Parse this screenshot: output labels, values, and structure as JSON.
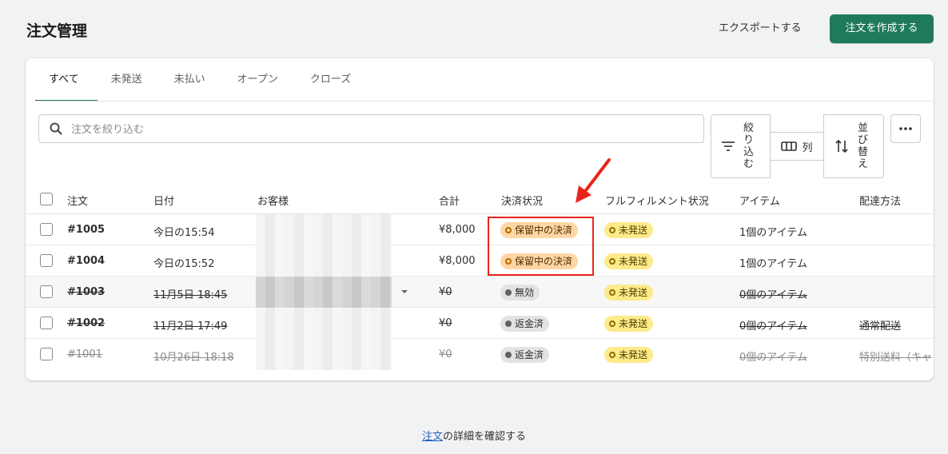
{
  "header": {
    "title": "注文管理",
    "export_label": "エクスポートする",
    "create_label": "注文を作成する"
  },
  "tabs": [
    {
      "label": "すべて",
      "active": true
    },
    {
      "label": "未発送",
      "active": false
    },
    {
      "label": "未払い",
      "active": false
    },
    {
      "label": "オープン",
      "active": false
    },
    {
      "label": "クローズ",
      "active": false
    }
  ],
  "search": {
    "placeholder": "注文を絞り込む",
    "icon": "search-icon"
  },
  "toolbar": {
    "filter_label": [
      "絞",
      "り",
      "込",
      "む"
    ],
    "columns_label": "列",
    "sort_label": [
      "並",
      "び",
      "替",
      "え"
    ],
    "more_icon": "more-horizontal-icon"
  },
  "columns": [
    "注文",
    "日付",
    "お客様",
    "合計",
    "決済状況",
    "フルフィルメント状況",
    "アイテム",
    "配達方法"
  ],
  "orders": [
    {
      "id": "#1005",
      "date": "今日の15:54",
      "total": "¥8,000",
      "payment": "保留中の決済",
      "fulfillment": "未発送",
      "items": "1個のアイテム",
      "delivery": ""
    },
    {
      "id": "#1004",
      "date": "今日の15:52",
      "total": "¥8,000",
      "payment": "保留中の決済",
      "fulfillment": "未発送",
      "items": "1個のアイテム",
      "delivery": ""
    },
    {
      "id": "#1003",
      "date": "11月5日 18:45",
      "total": "¥0",
      "payment": "無効",
      "fulfillment": "未発送",
      "items": "0個のアイテム",
      "delivery": ""
    },
    {
      "id": "#1002",
      "date": "11月2日 17:49",
      "total": "¥0",
      "payment": "返金済",
      "fulfillment": "未発送",
      "items": "0個のアイテム",
      "delivery": "通常配送"
    },
    {
      "id": "#1001",
      "date": "10月26日 18:18",
      "total": "¥0",
      "payment": "返金済",
      "fulfillment": "未発送",
      "items": "0個のアイテム",
      "delivery": "特別送料（キャ"
    }
  ],
  "footer": {
    "link": "注文",
    "text": "の詳細を確認する"
  },
  "colors": {
    "primary": "#1f7a5a",
    "annotation": "#e8251b",
    "pending_badge": "#ffd6a4",
    "unfulfilled_badge": "#ffea8a"
  }
}
